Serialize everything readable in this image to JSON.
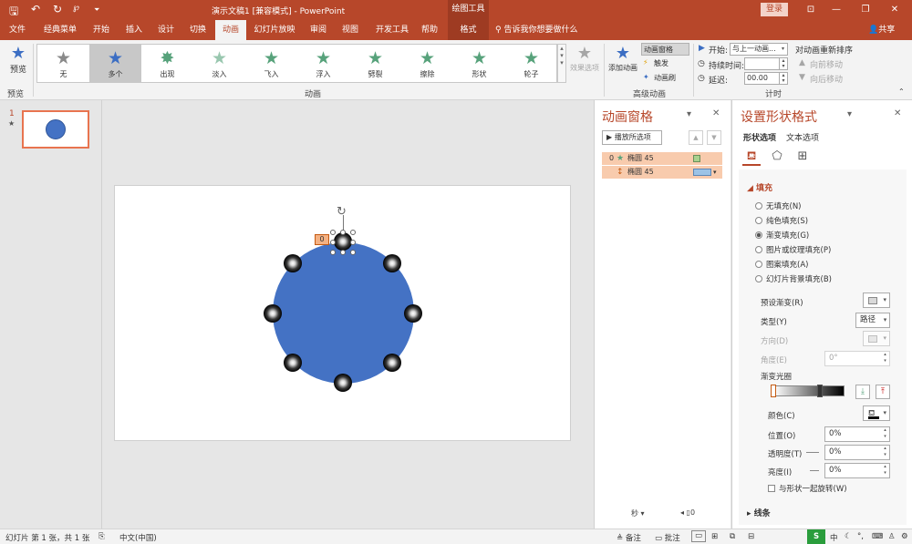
{
  "titlebar": {
    "title": "演示文稿1 [兼容模式] - PowerPoint",
    "drawing_tools": "绘图工具",
    "login": "登录",
    "qa_save": "🖫",
    "qa_undo": "↶",
    "qa_redo": "↻",
    "qa_custom": "⏷",
    "win_ribbon_opts": "⊡",
    "win_minimize": "—",
    "win_restore": "❐",
    "win_close": "✕"
  },
  "tabs": [
    "文件",
    "经典菜单",
    "开始",
    "插入",
    "设计",
    "切换",
    "动画",
    "幻灯片放映",
    "审阅",
    "视图",
    "开发工具",
    "帮助",
    "格式"
  ],
  "tell_me": "告诉我你想要做什么",
  "share": "共享",
  "ribbon": {
    "preview_label": "预览",
    "preview_group": "预览",
    "animation_group": "动画",
    "advanced_group": "高级动画",
    "timing_group": "计时",
    "gallery": [
      {
        "label": "无",
        "color": "gray"
      },
      {
        "label": "多个",
        "color": "blue"
      },
      {
        "label": "出现",
        "color": "green"
      },
      {
        "label": "淡入",
        "color": "green"
      },
      {
        "label": "飞入",
        "color": "green"
      },
      {
        "label": "浮入",
        "color": "green"
      },
      {
        "label": "劈裂",
        "color": "green"
      },
      {
        "label": "擦除",
        "color": "green"
      },
      {
        "label": "形状",
        "color": "green"
      },
      {
        "label": "轮子",
        "color": "green"
      }
    ],
    "effect_options": "效果选项",
    "add_animation": "添加动画",
    "animation_pane": "动画窗格",
    "trigger": "触发",
    "animation_painter": "动画刷",
    "start_label": "开始:",
    "start_value": "与上一动画...",
    "duration_label": "持续时间:",
    "duration_value": "",
    "delay_label": "延迟:",
    "delay_value": "00.00",
    "reorder": "对动画重新排序",
    "move_earlier": "向前移动",
    "move_later": "向后移动"
  },
  "thumbnail": {
    "number": "1",
    "star": "★"
  },
  "slide": {
    "anim_tag": "0"
  },
  "animation_pane": {
    "title": "动画窗格",
    "play_all": "播放所选项",
    "rows": [
      {
        "seq": "0",
        "icon": "★",
        "name": "椭圆 45"
      },
      {
        "seq": "",
        "icon": "↕",
        "name": "椭圆 45"
      }
    ],
    "footer": "秒 ▾"
  },
  "format_pane": {
    "title": "设置形状格式",
    "tab_shape": "形状选项",
    "tab_text": "文本选项",
    "fill_header": "◢ 填充",
    "fill_options": [
      {
        "label": "无填充(N)",
        "checked": false
      },
      {
        "label": "纯色填充(S)",
        "checked": false
      },
      {
        "label": "渐变填充(G)",
        "checked": true
      },
      {
        "label": "图片或纹理填充(P)",
        "checked": false
      },
      {
        "label": "图案填充(A)",
        "checked": false
      },
      {
        "label": "幻灯片背景填充(B)",
        "checked": false
      }
    ],
    "preset_gradient": "预设渐变(R)",
    "type_label": "类型(Y)",
    "type_value": "路径",
    "direction_label": "方向(D)",
    "angle_label": "角度(E)",
    "angle_value": "0°",
    "gradient_stops": "渐变光圈",
    "color_label": "颜色(C)",
    "position_label": "位置(O)",
    "position_value": "0%",
    "transparency_label": "透明度(T)",
    "transparency_value": "0%",
    "brightness_label": "亮度(I)",
    "brightness_value": "0%",
    "rotate_with_shape": "与形状一起旋转(W)",
    "line_header": "▸ 线条"
  },
  "statusbar": {
    "slide_info": "幻灯片 第 1 张，共 1 张",
    "language": "中文(中国)",
    "notes": "备注",
    "comments": "批注"
  },
  "colors": {
    "accent": "#b7472a",
    "shape_fill": "#4472c4",
    "selection_row": "#f8cbad"
  }
}
